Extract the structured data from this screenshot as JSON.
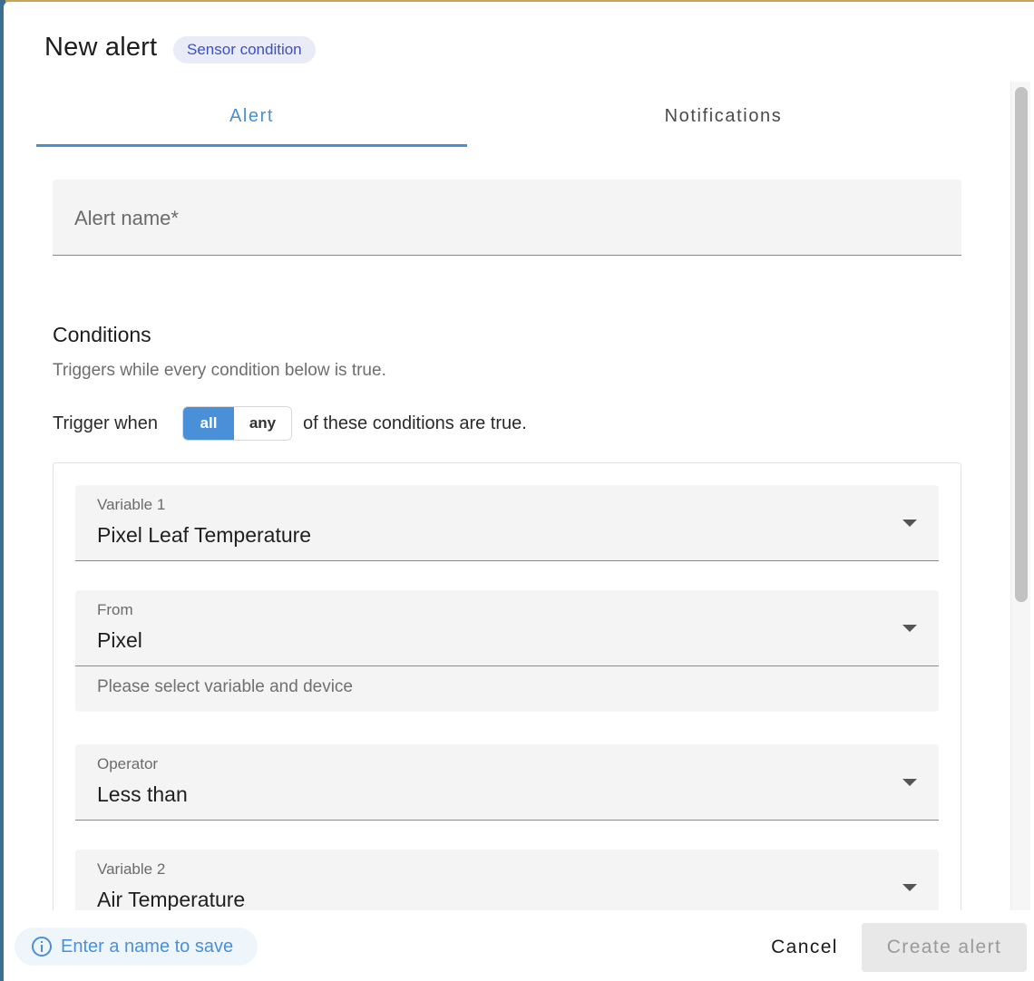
{
  "dialog": {
    "title": "New alert",
    "badge": "Sensor condition"
  },
  "tabs": [
    {
      "label": "Alert",
      "active": true
    },
    {
      "label": "Notifications",
      "active": false
    }
  ],
  "form": {
    "alert_name_label": "Alert name*",
    "alert_name_value": ""
  },
  "conditions": {
    "title": "Conditions",
    "subtitle": "Triggers while every condition below is true.",
    "trigger_prefix": "Trigger when",
    "toggle_options": [
      "all",
      "any"
    ],
    "toggle_selected": "all",
    "trigger_suffix": "of these conditions are true.",
    "fields": {
      "variable1": {
        "label": "Variable 1",
        "value": "Pixel Leaf Temperature"
      },
      "from": {
        "label": "From",
        "value": "Pixel",
        "helper": "Please select variable and device"
      },
      "operator": {
        "label": "Operator",
        "value": "Less than"
      },
      "variable2": {
        "label": "Variable 2",
        "value": "Air Temperature"
      }
    }
  },
  "footer": {
    "hint": "Enter a name to save",
    "cancel_label": "Cancel",
    "create_label": "Create alert"
  },
  "colors": {
    "accent": "#4a90d9",
    "badge_bg": "#e9ecf7",
    "badge_text": "#3d4fc4",
    "disabled_button_bg": "#e8e8e8"
  },
  "icons": {
    "hint": "info-icon",
    "select": "caret-down-icon"
  }
}
